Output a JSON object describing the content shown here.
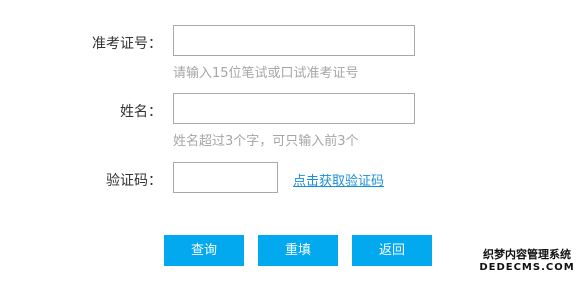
{
  "form": {
    "exam_id": {
      "label": "准考证号：",
      "value": "",
      "hint": "请输入15位笔试或口试准考证号"
    },
    "name": {
      "label": "姓名：",
      "value": "",
      "hint": "姓名超过3个字，可只输入前3个"
    },
    "captcha": {
      "label": "验证码：",
      "value": "",
      "link": "点击获取验证码"
    }
  },
  "buttons": {
    "query": "查询",
    "reset": "重填",
    "back": "返回"
  },
  "watermark": {
    "line1": "织梦内容管理系统",
    "line2": "DEDECMS.COM"
  }
}
